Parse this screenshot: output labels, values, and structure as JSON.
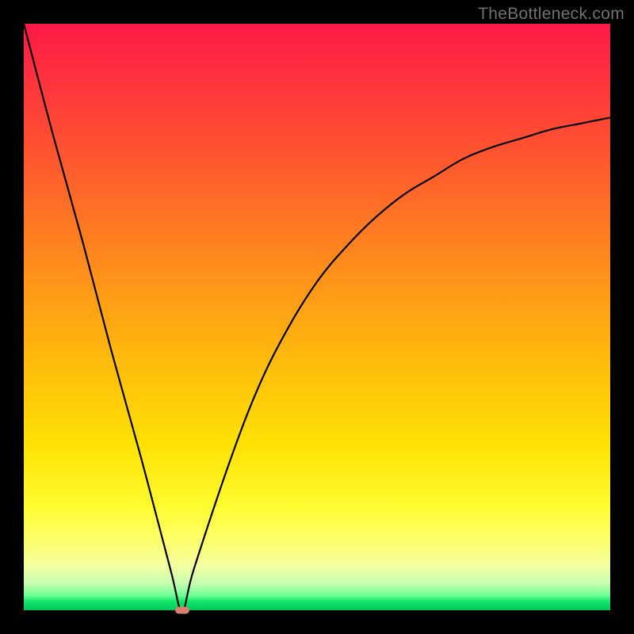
{
  "watermark": "TheBottleneck.com",
  "colors": {
    "frame": "#000000",
    "gradient_top": "#ff1846",
    "gradient_mid1": "#ff7a22",
    "gradient_mid2": "#ffe205",
    "gradient_bottom": "#00c95a",
    "curve": "#000000",
    "marker": "#d97f6c"
  },
  "chart_data": {
    "type": "line",
    "title": "",
    "xlabel": "",
    "ylabel": "",
    "xlim": [
      0,
      100
    ],
    "ylim": [
      0,
      100
    ],
    "x": [
      0,
      5,
      10,
      15,
      20,
      25,
      27,
      29,
      35,
      40,
      45,
      50,
      55,
      60,
      65,
      70,
      75,
      80,
      85,
      90,
      95,
      100
    ],
    "values": [
      100,
      81,
      63,
      44,
      26,
      7,
      0,
      7,
      25,
      38,
      48,
      56,
      62,
      67,
      71,
      74,
      77,
      79,
      80.5,
      82,
      83,
      84
    ],
    "minimum_x": 27,
    "minimum_y": 0,
    "series": [
      {
        "name": "bottleneck-curve",
        "x": [
          0,
          5,
          10,
          15,
          20,
          25,
          27,
          29,
          35,
          40,
          45,
          50,
          55,
          60,
          65,
          70,
          75,
          80,
          85,
          90,
          95,
          100
        ],
        "y": [
          100,
          81,
          63,
          44,
          26,
          7,
          0,
          7,
          25,
          38,
          48,
          56,
          62,
          67,
          71,
          74,
          77,
          79,
          80.5,
          82,
          83,
          84
        ]
      }
    ],
    "annotations": []
  }
}
